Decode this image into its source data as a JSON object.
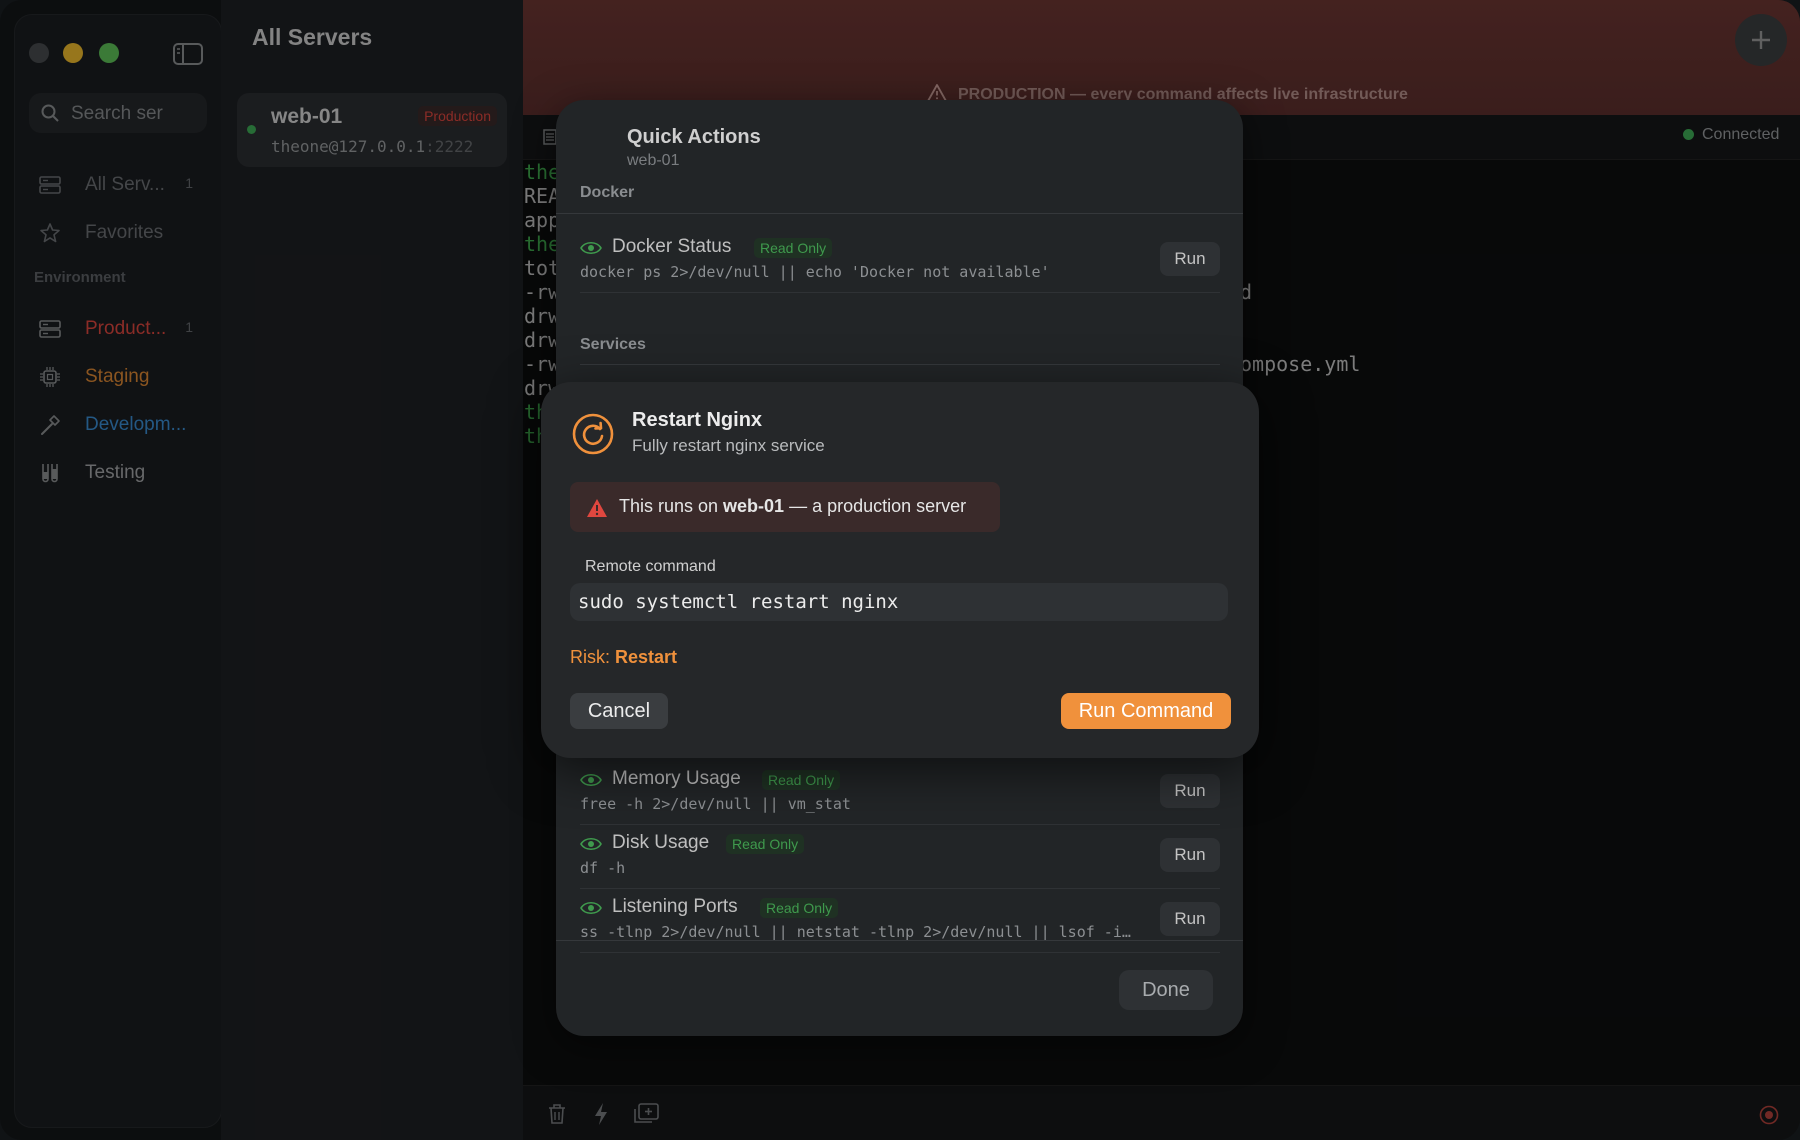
{
  "sidebar": {
    "search_placeholder": "Search ser",
    "items": [
      {
        "label": "All Serv...",
        "count": "1"
      },
      {
        "label": "Favorites",
        "count": ""
      }
    ],
    "section_title": "Environment",
    "environments": [
      {
        "label": "Product...",
        "count": "1",
        "color": "#e0473f"
      },
      {
        "label": "Staging",
        "count": "",
        "color": "#e08a35"
      },
      {
        "label": "Developm...",
        "count": "",
        "color": "#3a8fd6"
      },
      {
        "label": "Testing",
        "count": "",
        "color": "#a7a9ab"
      }
    ]
  },
  "server_list": {
    "title": "All Servers",
    "servers": [
      {
        "name": "web-01",
        "badge": "Production",
        "address": "theone@127.0.0.1",
        "port": ":2222"
      }
    ]
  },
  "banner": {
    "text": "PRODUCTION — every command affects live infrastructure"
  },
  "terminal": {
    "status": "Connected",
    "lines_left": [
      "the",
      "REA",
      "app",
      "the",
      "tot",
      "-rw",
      "drw",
      "drw",
      "-rw",
      "drw",
      "th",
      "th"
    ],
    "fragment_d": "d",
    "fragment_compose": "ompose.yml"
  },
  "quick_actions": {
    "title": "Quick Actions",
    "subtitle": "web-01",
    "section_docker": "Docker",
    "section_services": "Services",
    "actions": [
      {
        "name": "Docker Status",
        "badge": "Read Only",
        "cmd": "docker ps 2>/dev/null || echo 'Docker not available'",
        "run": "Run"
      },
      {
        "name": "Memory Usage",
        "badge": "Read Only",
        "cmd": "free -h 2>/dev/null || vm_stat",
        "run": "Run"
      },
      {
        "name": "Disk Usage",
        "badge": "Read Only",
        "cmd": "df -h",
        "run": "Run"
      },
      {
        "name": "Listening Ports",
        "badge": "Read Only",
        "cmd": "ss -tlnp 2>/dev/null || netstat -tlnp 2>/dev/null || lsof -i…",
        "run": "Run"
      }
    ],
    "done": "Done"
  },
  "dialog": {
    "title": "Restart Nginx",
    "subtitle": "Fully restart nginx service",
    "warning_prefix": "This runs on ",
    "warning_server": "web-01",
    "warning_suffix": " — a production server",
    "command_label": "Remote command",
    "command": "sudo systemctl restart nginx",
    "risk_label": "Risk: ",
    "risk_value": "Restart",
    "cancel": "Cancel",
    "confirm": "Run Command"
  },
  "colors": {
    "accent_orange": "#f0913c",
    "production_red": "#e0473f",
    "read_only_green": "#3f9a4d",
    "connected_green": "#3fae57"
  }
}
